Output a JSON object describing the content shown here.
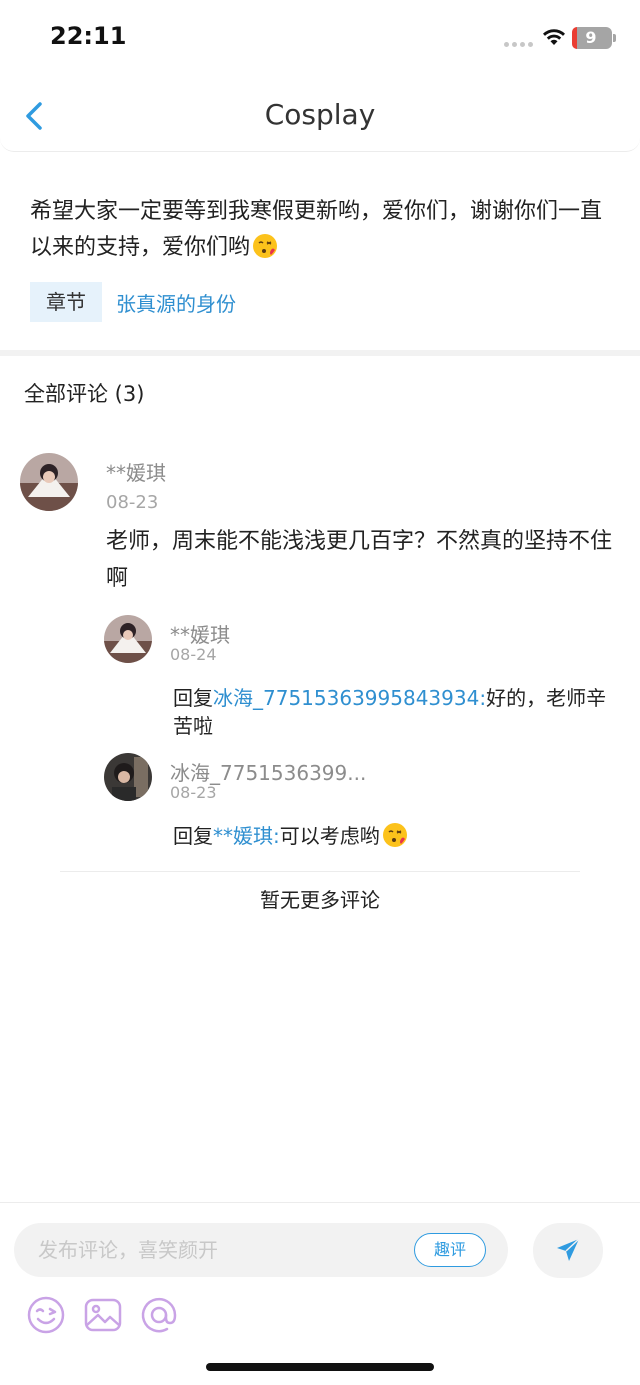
{
  "status_bar": {
    "time": "22:11",
    "battery": "9"
  },
  "nav": {
    "title": "Cosplay"
  },
  "intro": {
    "text": "希望大家一定要等到我寒假更新哟，爱你们，谢谢你们一直以来的支持，爱你们哟",
    "chapter_tag": "章节",
    "chapter_link": "张真源的身份"
  },
  "comments": {
    "header": "全部评论 (3)",
    "main": {
      "user": "**媛琪",
      "date": "08-23",
      "text": "老师，周末能不能浅浅更几百字？不然真的坚持不住啊"
    },
    "replies": [
      {
        "user": "**媛琪",
        "date": "08-24",
        "prefix": "回复",
        "target": "冰海_77515363995843934",
        "colon": ":",
        "text": "好的，老师辛苦啦"
      },
      {
        "user": "冰海_7751536399...",
        "date": "08-23",
        "prefix": "回复",
        "target": "**媛琪",
        "colon": ":",
        "text": "可以考虑哟"
      }
    ],
    "no_more": "暂无更多评论"
  },
  "bottom": {
    "input_placeholder": "发布评论，喜笑颜开",
    "quping_label": "趣评"
  },
  "icons": {
    "back": "chevron-left-icon",
    "send": "send-icon",
    "emoji_tool": "emoji-icon",
    "image_tool": "image-icon",
    "mention_tool": "at-icon"
  },
  "colors": {
    "accent": "#2f9be0",
    "link": "#2f8fd0",
    "tool_icons": "#c9a3e6"
  }
}
